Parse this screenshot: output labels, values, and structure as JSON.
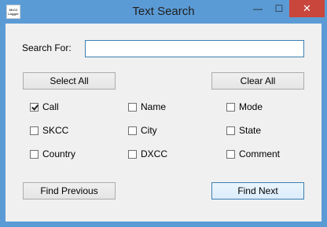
{
  "window": {
    "title": "Text Search",
    "icon_text": [
      "SKCC",
      "Logger"
    ],
    "controls": {
      "minimize": "—",
      "maximize": "☐",
      "close": "✕"
    }
  },
  "search": {
    "label": "Search For:",
    "value": "",
    "placeholder": ""
  },
  "buttons": {
    "select_all": "Select All",
    "clear_all": "Clear All",
    "find_previous": "Find Previous",
    "find_next": "Find Next"
  },
  "checkboxes": [
    {
      "label": "Call",
      "checked": true
    },
    {
      "label": "Name",
      "checked": false
    },
    {
      "label": "Mode",
      "checked": false
    },
    {
      "label": "SKCC",
      "checked": false
    },
    {
      "label": "City",
      "checked": false
    },
    {
      "label": "State",
      "checked": false
    },
    {
      "label": "Country",
      "checked": false
    },
    {
      "label": "DXCC",
      "checked": false
    },
    {
      "label": "Comment",
      "checked": false
    }
  ],
  "colors": {
    "titlebar": "#5b9bd5",
    "close": "#c9463d",
    "client": "#f0f0f0",
    "focus": "#3c7fb1"
  }
}
